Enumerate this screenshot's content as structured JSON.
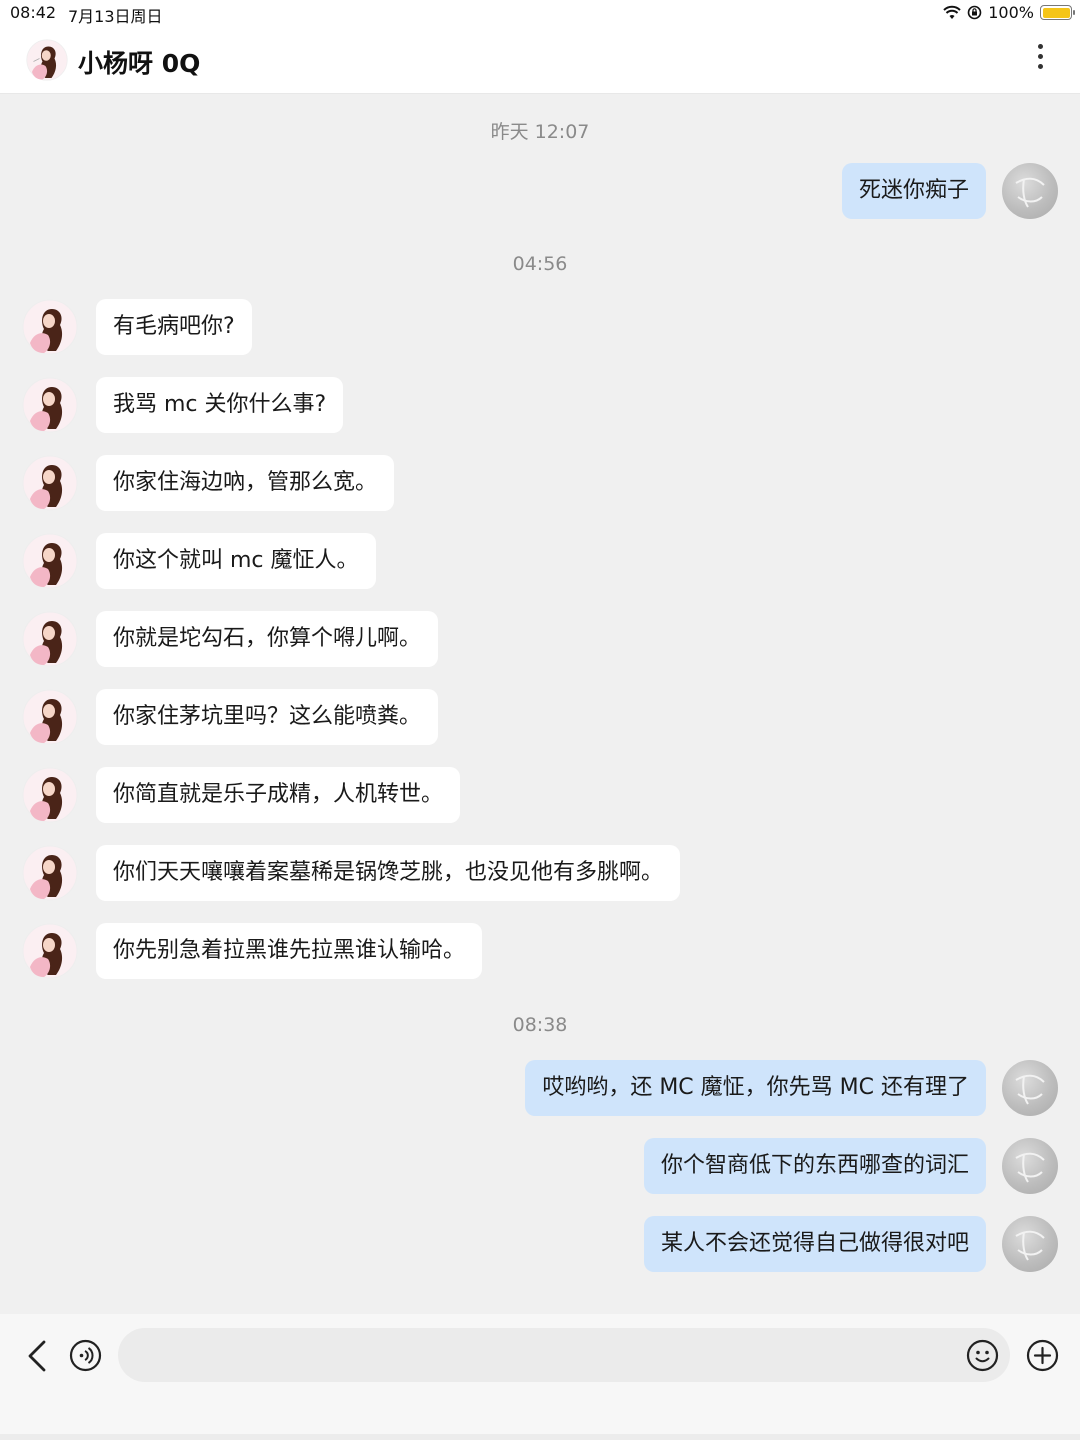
{
  "status": {
    "time": "08:42",
    "date": "7月13日周日",
    "battery": "100%"
  },
  "header": {
    "title": "小杨呀 0Q"
  },
  "timestamps": [
    "昨天 12:07",
    "04:56",
    "08:38"
  ],
  "messages": [
    {
      "side": "right",
      "text": "死迷你痴子"
    },
    {
      "side": "left",
      "text": "有毛病吧你?"
    },
    {
      "side": "left",
      "text": "我骂 mc 关你什么事?"
    },
    {
      "side": "left",
      "text": "你家住海边吶，管那么宽。"
    },
    {
      "side": "left",
      "text": "你这个就叫 mc 魔怔人。"
    },
    {
      "side": "left",
      "text": "你就是坨勾石，你算个嘚儿啊。"
    },
    {
      "side": "left",
      "text": "你家住茅坑里吗？这么能喷粪。"
    },
    {
      "side": "left",
      "text": "你简直就是乐子成精，人机转世。"
    },
    {
      "side": "left",
      "text": "你们天天嚷嚷着案墓稀是锅馋芝朓，也没见他有多朓啊。"
    },
    {
      "side": "left",
      "text": "你先别急着拉黑谁先拉黑谁认输哈。"
    },
    {
      "side": "right",
      "text": "哎哟哟，还 MC 魔怔，你先骂 MC 还有理了"
    },
    {
      "side": "right",
      "text": "你个智商低下的东西哪查的词汇"
    },
    {
      "side": "right",
      "text": "某人不会还觉得自己做得很对吧"
    }
  ],
  "colors": {
    "my_bubble": "#cfe4fb",
    "their_bubble": "#ffffff",
    "background": "#f0f0f0",
    "battery": "#f5c518"
  },
  "icons": [
    "wifi-icon",
    "rotation-lock-icon",
    "battery-icon",
    "more-icon",
    "back-icon",
    "voice-icon",
    "emoji-icon",
    "plus-icon"
  ]
}
